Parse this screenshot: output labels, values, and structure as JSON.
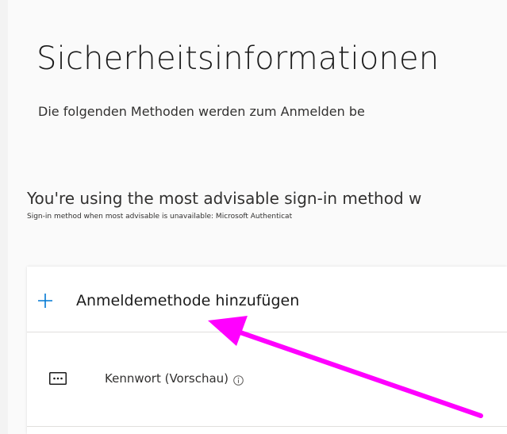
{
  "header": {
    "title": "Sicherheitsinformationen",
    "subtitle": "Die folgenden Methoden werden zum Anmelden be"
  },
  "advisory": {
    "headline": "You're using the most advisable sign-in method w",
    "detail": "Sign-in method when most advisable is unavailable: Microsoft Authenticat"
  },
  "methods_card": {
    "add_method": {
      "icon": "plus-icon",
      "label": "Anmeldemethode hinzufügen"
    },
    "items": [
      {
        "icon": "password-icon",
        "label": "Kennwort (Vorschau)",
        "info_icon": "info-icon"
      }
    ]
  },
  "annotation": {
    "type": "arrow",
    "color": "#ff00ff"
  },
  "colors": {
    "accent": "#0078d4",
    "annotation": "#ff00ff"
  }
}
